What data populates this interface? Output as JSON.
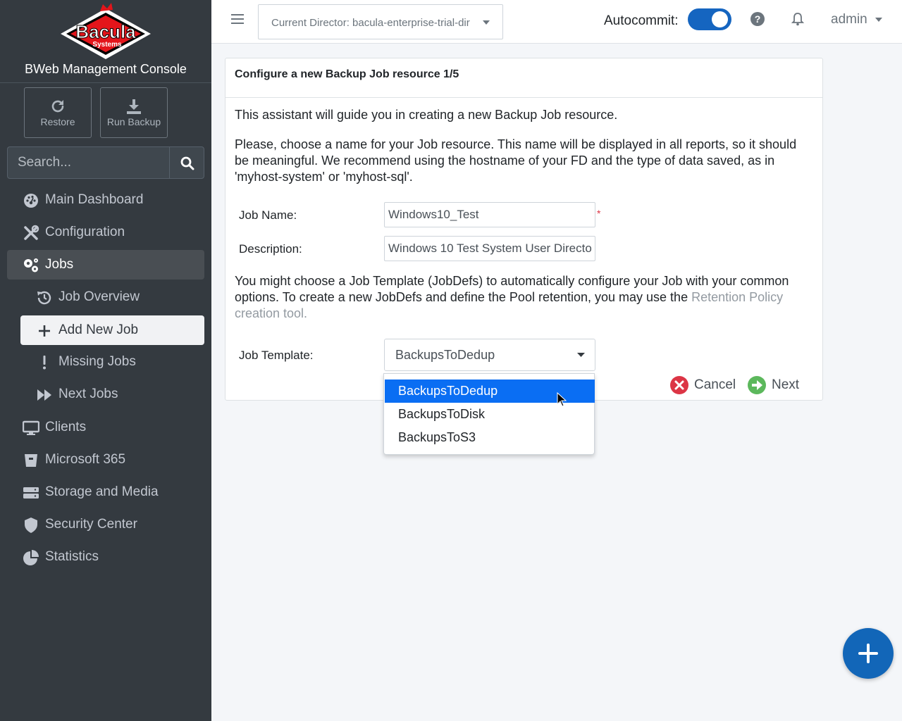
{
  "brand": {
    "logo_text": "Bacula",
    "logo_sub": "Systems",
    "console_title": "BWeb Management Console"
  },
  "quick_actions": {
    "restore": "Restore",
    "run_backup": "Run Backup"
  },
  "search": {
    "placeholder": "Search..."
  },
  "nav": {
    "main_dashboard": "Main Dashboard",
    "configuration": "Configuration",
    "jobs": "Jobs",
    "job_overview": "Job Overview",
    "add_new_job": "Add New Job",
    "missing_jobs": "Missing Jobs",
    "next_jobs": "Next Jobs",
    "clients": "Clients",
    "microsoft_365": "Microsoft 365",
    "storage_and_media": "Storage and Media",
    "security_center": "Security Center",
    "statistics": "Statistics"
  },
  "header": {
    "director_label": "Current Director: bacula-enterprise-trial-dir",
    "autocommit_label": "Autocommit:",
    "autocommit_on": true,
    "user": "admin"
  },
  "wizard": {
    "title": "Configure a new Backup Job resource 1/5",
    "intro": "This assistant will guide you in creating a new Backup Job resource.",
    "name_help": "Please, choose a name for your Job resource. This name will be displayed in all reports, so it should be meaningful. We recommend using the hostname of your FD and the type of data saved, as in 'myhost-system' or 'myhost-sql'.",
    "job_name_label": "Job Name:",
    "job_name_value": "Windows10_Test",
    "required_mark": "*",
    "description_label": "Description:",
    "description_value": "Windows 10 Test System User Directo",
    "template_help": "You might choose a Job Template (JobDefs) to automatically configure your Job with your common options. To create a new JobDefs and define the Pool retention, you may use the",
    "template_help_link": "Retention Policy creation tool.",
    "job_template_label": "Job Template:",
    "job_template_value": "BackupsToDedup",
    "template_options": [
      "BackupsToDedup",
      "BackupsToDisk",
      "BackupsToS3"
    ],
    "cancel_label": "Cancel",
    "next_label": "Next"
  },
  "colors": {
    "sidebar_bg": "#343a40",
    "accent_blue": "#1266b8",
    "selected_option": "#0a6ef3",
    "cancel_red": "#dc3545",
    "next_green": "#28a745"
  }
}
